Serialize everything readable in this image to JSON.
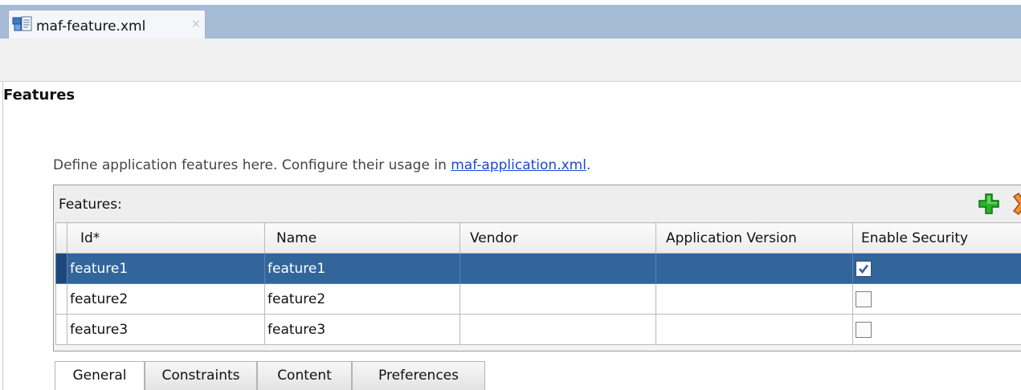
{
  "editor": {
    "tab_label": "maf-feature.xml",
    "tab_close": "×",
    "tab_icon": "xml-file-icon"
  },
  "section_title": "Features",
  "description": {
    "text": "Define application features here. Configure their usage in ",
    "link": "maf-application.xml",
    "suffix": "."
  },
  "panel": {
    "title": "Features:",
    "add_icon": "add-icon",
    "delete_icon": "delete-icon",
    "columns": [
      "Id*",
      "Name",
      "Vendor",
      "Application Version",
      "Enable Security"
    ],
    "rows": [
      {
        "id": "feature1",
        "name": "feature1",
        "vendor": "",
        "app_version": "",
        "enable_security": true,
        "selected": true
      },
      {
        "id": "feature2",
        "name": "feature2",
        "vendor": "",
        "app_version": "",
        "enable_security": false,
        "selected": false
      },
      {
        "id": "feature3",
        "name": "feature3",
        "vendor": "",
        "app_version": "",
        "enable_security": false,
        "selected": false
      }
    ]
  },
  "subtabs": [
    "General",
    "Constraints",
    "Content",
    "Preferences"
  ],
  "active_subtab": "General",
  "colors": {
    "tabstrip": "#a6bcd6",
    "selection": "#32659a",
    "link": "#1a49d6",
    "add_green": "#22aa22",
    "delete_orange": "#e0802a"
  }
}
